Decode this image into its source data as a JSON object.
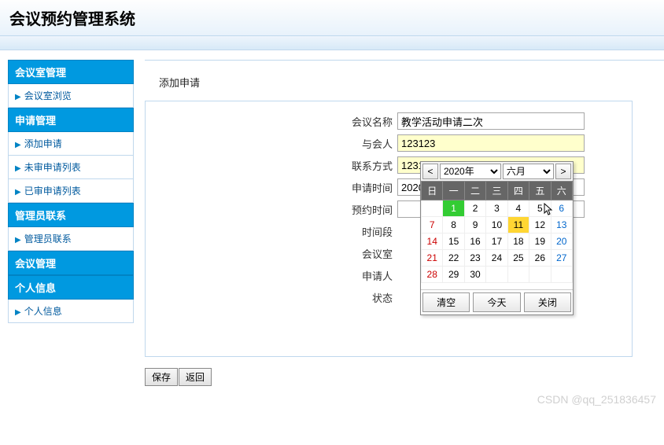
{
  "header": {
    "title": "会议预约管理系统"
  },
  "sidebar": {
    "sections": [
      {
        "title": "会议室管理",
        "items": [
          {
            "label": "会议室浏览"
          }
        ]
      },
      {
        "title": "申请管理",
        "items": [
          {
            "label": "添加申请"
          },
          {
            "label": "未审申请列表"
          },
          {
            "label": "已审申请列表"
          }
        ]
      },
      {
        "title": "管理员联系",
        "items": [
          {
            "label": "管理员联系"
          }
        ]
      },
      {
        "title": "会议管理",
        "items": []
      },
      {
        "title": "个人信息",
        "items": [
          {
            "label": "个人信息"
          }
        ]
      }
    ]
  },
  "panel": {
    "title": "添加申请",
    "fields": {
      "meeting_name": {
        "label": "会议名称",
        "value": "教学活动申请二次"
      },
      "participants": {
        "label": "与会人",
        "value": "123123"
      },
      "contact": {
        "label": "联系方式",
        "value": "12312312"
      },
      "apply_time": {
        "label": "申请时间",
        "value": "2020/6/1 12:26:24"
      },
      "reserve_time": {
        "label": "预约时间",
        "value": ""
      },
      "time_slot": {
        "label": "时间段"
      },
      "room": {
        "label": "会议室"
      },
      "applicant": {
        "label": "申请人"
      },
      "status": {
        "label": "状态"
      }
    },
    "buttons": {
      "save": "保存",
      "back": "返回"
    }
  },
  "calendar": {
    "prev": "<",
    "next": ">",
    "year": "2020年",
    "month": "六月",
    "weekdays": [
      "日",
      "一",
      "二",
      "三",
      "四",
      "五",
      "六"
    ],
    "weeks": [
      [
        {
          "d": "",
          "c": ""
        },
        {
          "d": 1,
          "c": "green"
        },
        {
          "d": 2,
          "c": ""
        },
        {
          "d": 3,
          "c": ""
        },
        {
          "d": 4,
          "c": ""
        },
        {
          "d": 5,
          "c": ""
        },
        {
          "d": 6,
          "c": "sat"
        }
      ],
      [
        {
          "d": 7,
          "c": "sun"
        },
        {
          "d": 8,
          "c": ""
        },
        {
          "d": 9,
          "c": ""
        },
        {
          "d": 10,
          "c": ""
        },
        {
          "d": 11,
          "c": "yellow"
        },
        {
          "d": 12,
          "c": ""
        },
        {
          "d": 13,
          "c": "sat"
        }
      ],
      [
        {
          "d": 14,
          "c": "sun"
        },
        {
          "d": 15,
          "c": ""
        },
        {
          "d": 16,
          "c": ""
        },
        {
          "d": 17,
          "c": ""
        },
        {
          "d": 18,
          "c": ""
        },
        {
          "d": 19,
          "c": ""
        },
        {
          "d": 20,
          "c": "sat"
        }
      ],
      [
        {
          "d": 21,
          "c": "sun"
        },
        {
          "d": 22,
          "c": ""
        },
        {
          "d": 23,
          "c": ""
        },
        {
          "d": 24,
          "c": ""
        },
        {
          "d": 25,
          "c": ""
        },
        {
          "d": 26,
          "c": ""
        },
        {
          "d": 27,
          "c": "sat"
        }
      ],
      [
        {
          "d": 28,
          "c": "sun"
        },
        {
          "d": 29,
          "c": ""
        },
        {
          "d": 30,
          "c": ""
        },
        {
          "d": "",
          "c": ""
        },
        {
          "d": "",
          "c": ""
        },
        {
          "d": "",
          "c": ""
        },
        {
          "d": "",
          "c": ""
        }
      ]
    ],
    "footer": {
      "clear": "清空",
      "today": "今天",
      "close": "关闭"
    }
  },
  "watermark": "CSDN @qq_251836457"
}
